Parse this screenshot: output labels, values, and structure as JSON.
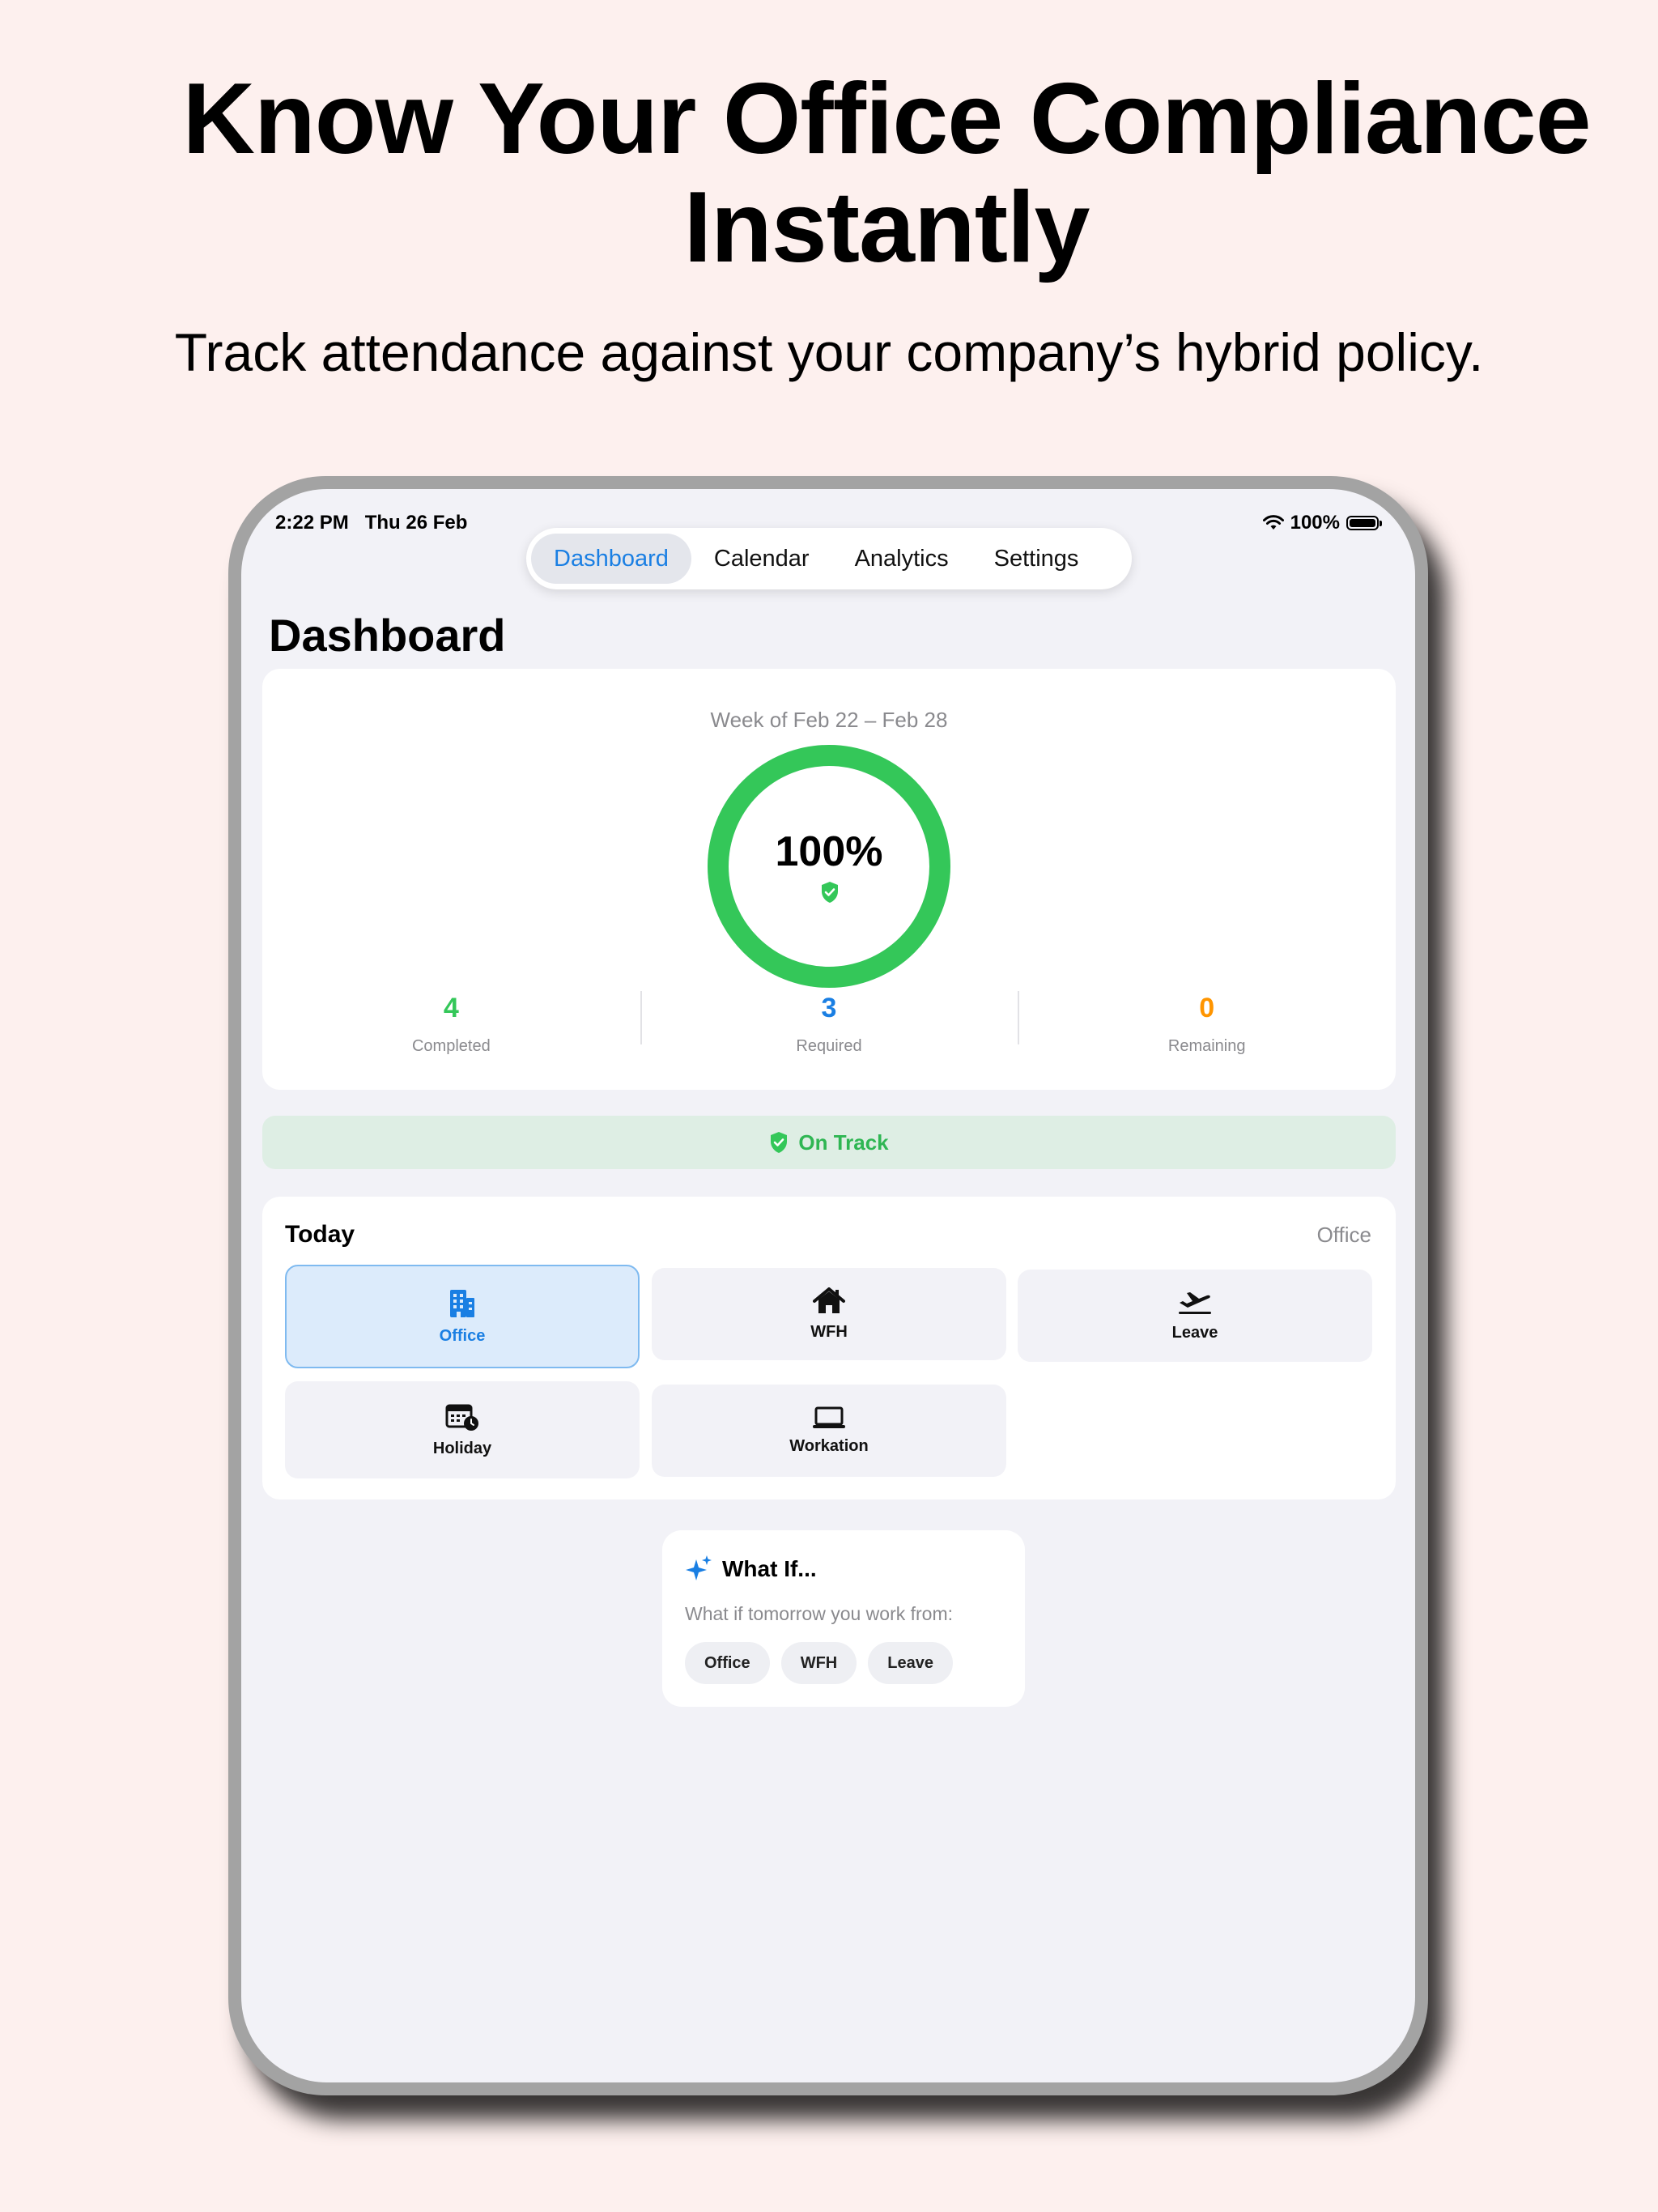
{
  "hero": {
    "title_line1": "Know Your Office Compliance",
    "title_line2": "Instantly",
    "subtitle": "Track attendance against your company’s hybrid policy."
  },
  "status_bar": {
    "time": "2:22 PM",
    "date": "Thu 26 Feb",
    "battery": "100%",
    "icons": [
      "wifi-icon",
      "battery-icon"
    ]
  },
  "tabs": [
    {
      "label": "Dashboard",
      "active": true
    },
    {
      "label": "Calendar",
      "active": false
    },
    {
      "label": "Analytics",
      "active": false
    },
    {
      "label": "Settings",
      "active": false
    }
  ],
  "page": {
    "title": "Dashboard"
  },
  "summary": {
    "week": "Week of Feb 22 – Feb 28",
    "percent_label": "100%",
    "progress": 1.0,
    "ring_color": "#34c759",
    "stats": [
      {
        "value": "4",
        "label": "Completed",
        "color": "#34c759"
      },
      {
        "value": "3",
        "label": "Required",
        "color": "#1a7fe3"
      },
      {
        "value": "0",
        "label": "Remaining",
        "color": "#ff9500"
      }
    ]
  },
  "status_banner": {
    "label": "On Track",
    "icon": "shield-check-icon"
  },
  "today": {
    "title": "Today",
    "value": "Office",
    "options": [
      {
        "label": "Office",
        "icon": "building-icon",
        "selected": true
      },
      {
        "label": "WFH",
        "icon": "house-icon",
        "selected": false
      },
      {
        "label": "Leave",
        "icon": "airplane-departure-icon",
        "selected": false
      },
      {
        "label": "Holiday",
        "icon": "calendar-clock-icon",
        "selected": false
      },
      {
        "label": "Workation",
        "icon": "laptop-icon",
        "selected": false
      }
    ]
  },
  "what_if": {
    "title": "What If...",
    "icon": "sparkles-icon",
    "question": "What if tomorrow you work from:",
    "options": [
      "Office",
      "WFH",
      "Leave"
    ]
  }
}
